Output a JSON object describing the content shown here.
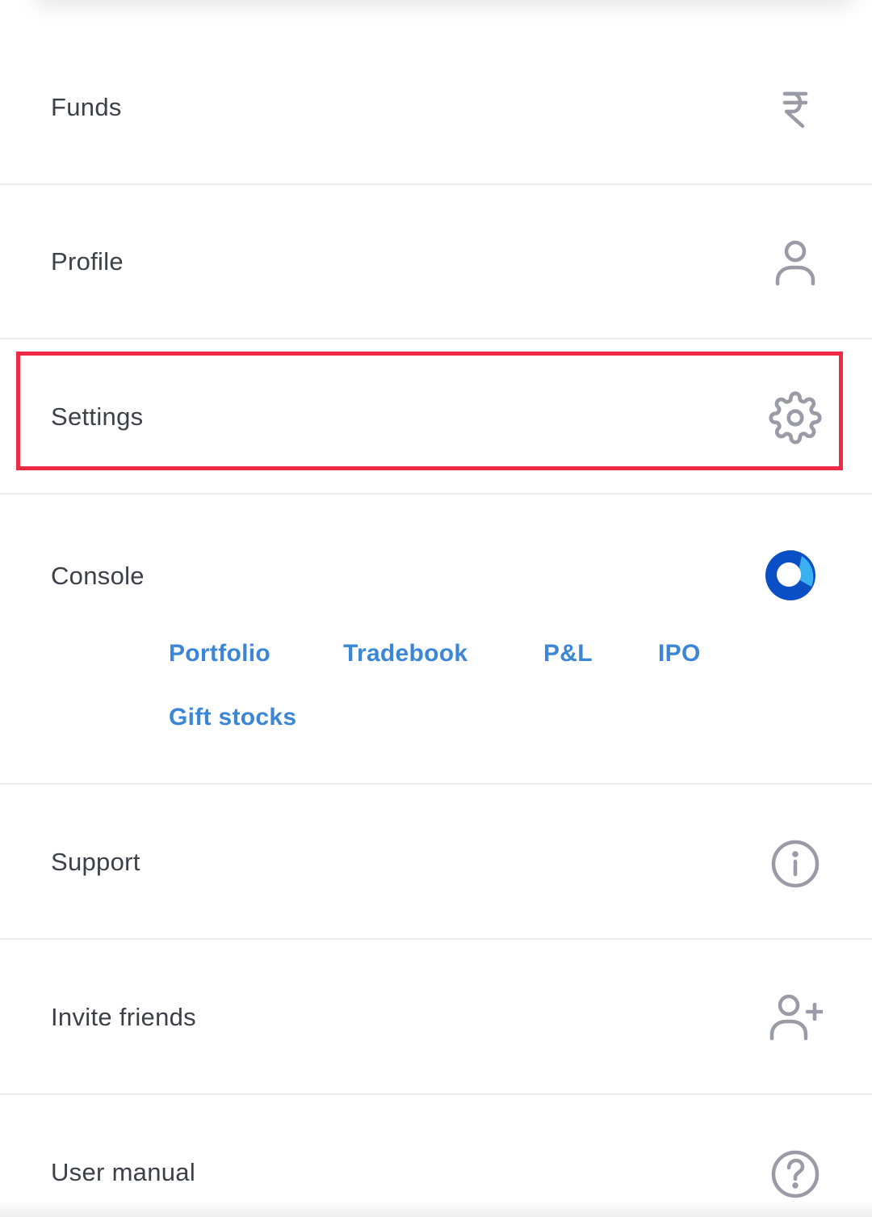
{
  "menu": {
    "funds": {
      "label": "Funds",
      "icon": "rupee-icon"
    },
    "profile": {
      "label": "Profile",
      "icon": "user-icon"
    },
    "settings": {
      "label": "Settings",
      "icon": "gear-icon"
    },
    "console": {
      "label": "Console",
      "icon": "console-logo-icon",
      "links": [
        "Portfolio",
        "Tradebook",
        "P&L",
        "IPO",
        "Gift stocks"
      ]
    },
    "support": {
      "label": "Support",
      "icon": "info-icon"
    },
    "invite": {
      "label": "Invite friends",
      "icon": "user-plus-icon"
    },
    "manual": {
      "label": "User manual",
      "icon": "help-icon"
    }
  },
  "colors": {
    "text": "#3c4049",
    "icon": "#9a9ba6",
    "link": "#3b86d6",
    "highlight": "#ee2a44",
    "divider": "#e9ebee",
    "console_dark": "#0b4fc4",
    "console_light": "#39b0f0"
  }
}
